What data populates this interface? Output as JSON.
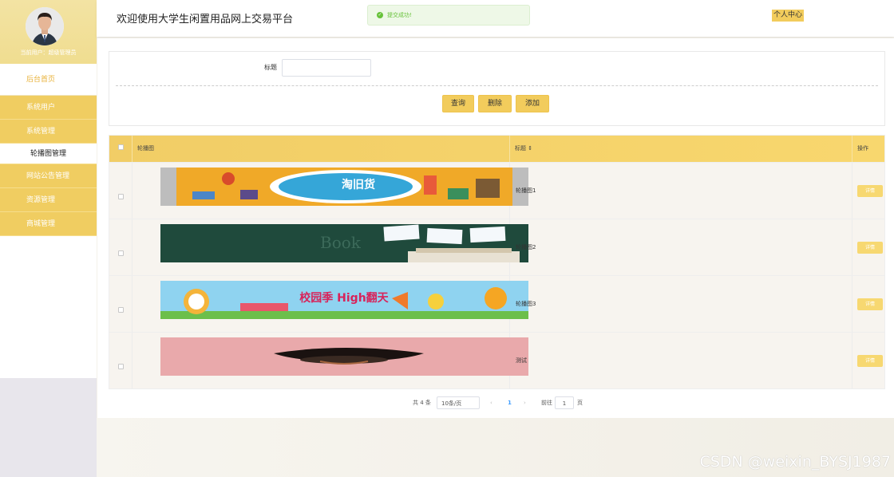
{
  "sidebar": {
    "user_line": "当前用户：超级管理员",
    "menu": [
      {
        "label": "后台首页"
      },
      {
        "label": "系统用户"
      },
      {
        "label": "系统管理"
      },
      {
        "label": "轮播图管理"
      },
      {
        "label": "网站公告管理"
      },
      {
        "label": "资源管理"
      },
      {
        "label": "商城管理"
      }
    ]
  },
  "header": {
    "title": "欢迎使用大学生闲置用品网上交易平台",
    "toast": "提交成功!",
    "personal_center": "个人中心"
  },
  "search": {
    "label": "标题",
    "value": "",
    "placeholder": "",
    "query_label": "查询",
    "delete_label": "删除",
    "add_label": "添加"
  },
  "table": {
    "headers": {
      "image": "轮播图",
      "title": "标题 ⇕",
      "actions": "操作"
    },
    "rows": [
      {
        "title": "轮播图1",
        "detail": "详情",
        "banner_text": "淘旧货"
      },
      {
        "title": "轮播图2",
        "detail": "详情",
        "banner_text": "Book"
      },
      {
        "title": "轮播图3",
        "detail": "详情",
        "banner_text": "校园季 High翻天"
      },
      {
        "title": "测试",
        "detail": "详情",
        "banner_text": ""
      }
    ]
  },
  "pagination": {
    "total": "共 4 条",
    "page_size": "10条/页",
    "prev": "‹",
    "current": "1",
    "next": "›",
    "goto": "前往",
    "goto_value": "1",
    "page_unit": "页"
  },
  "watermark": "CSDN @weixin_BYSJ1987",
  "colors": {
    "accent": "#f2cc5c",
    "success": "#67c23a",
    "link": "#409eff"
  }
}
